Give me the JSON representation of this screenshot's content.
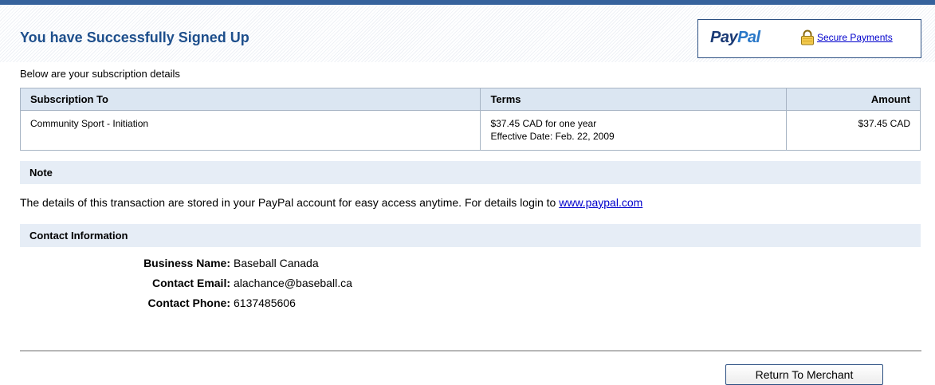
{
  "header": {
    "title": "You have Successfully Signed Up",
    "logo_pay": "Pay",
    "logo_pal": "Pal",
    "secure_link": "Secure Payments"
  },
  "intro": "Below are your subscription details",
  "subscription": {
    "columns": [
      "Subscription To",
      "Terms",
      "Amount"
    ],
    "row": {
      "item": "Community Sport - Initiation",
      "terms_line1": "$37.45 CAD for one year",
      "terms_line2": "Effective Date: Feb. 22, 2009",
      "amount": "$37.45 CAD"
    }
  },
  "note": {
    "heading": "Note",
    "text": "The details of this transaction are stored in your PayPal account for easy access anytime. For details login to ",
    "link": "www.paypal.com"
  },
  "contact": {
    "heading": "Contact Information",
    "business_label": "Business Name:",
    "business_value": "Baseball Canada",
    "email_label": "Contact Email:",
    "email_value": "alachance@baseball.ca",
    "phone_label": "Contact Phone:",
    "phone_value": "6137485606"
  },
  "footer": {
    "return_button": "Return To Merchant"
  },
  "colors": {
    "accent": "#36629c",
    "title": "#1e4f8c",
    "table_header": "#dbe6f2",
    "section_bar": "#e6edf6",
    "link": "#0000cc"
  },
  "icons": {
    "lock": "lock-icon"
  }
}
